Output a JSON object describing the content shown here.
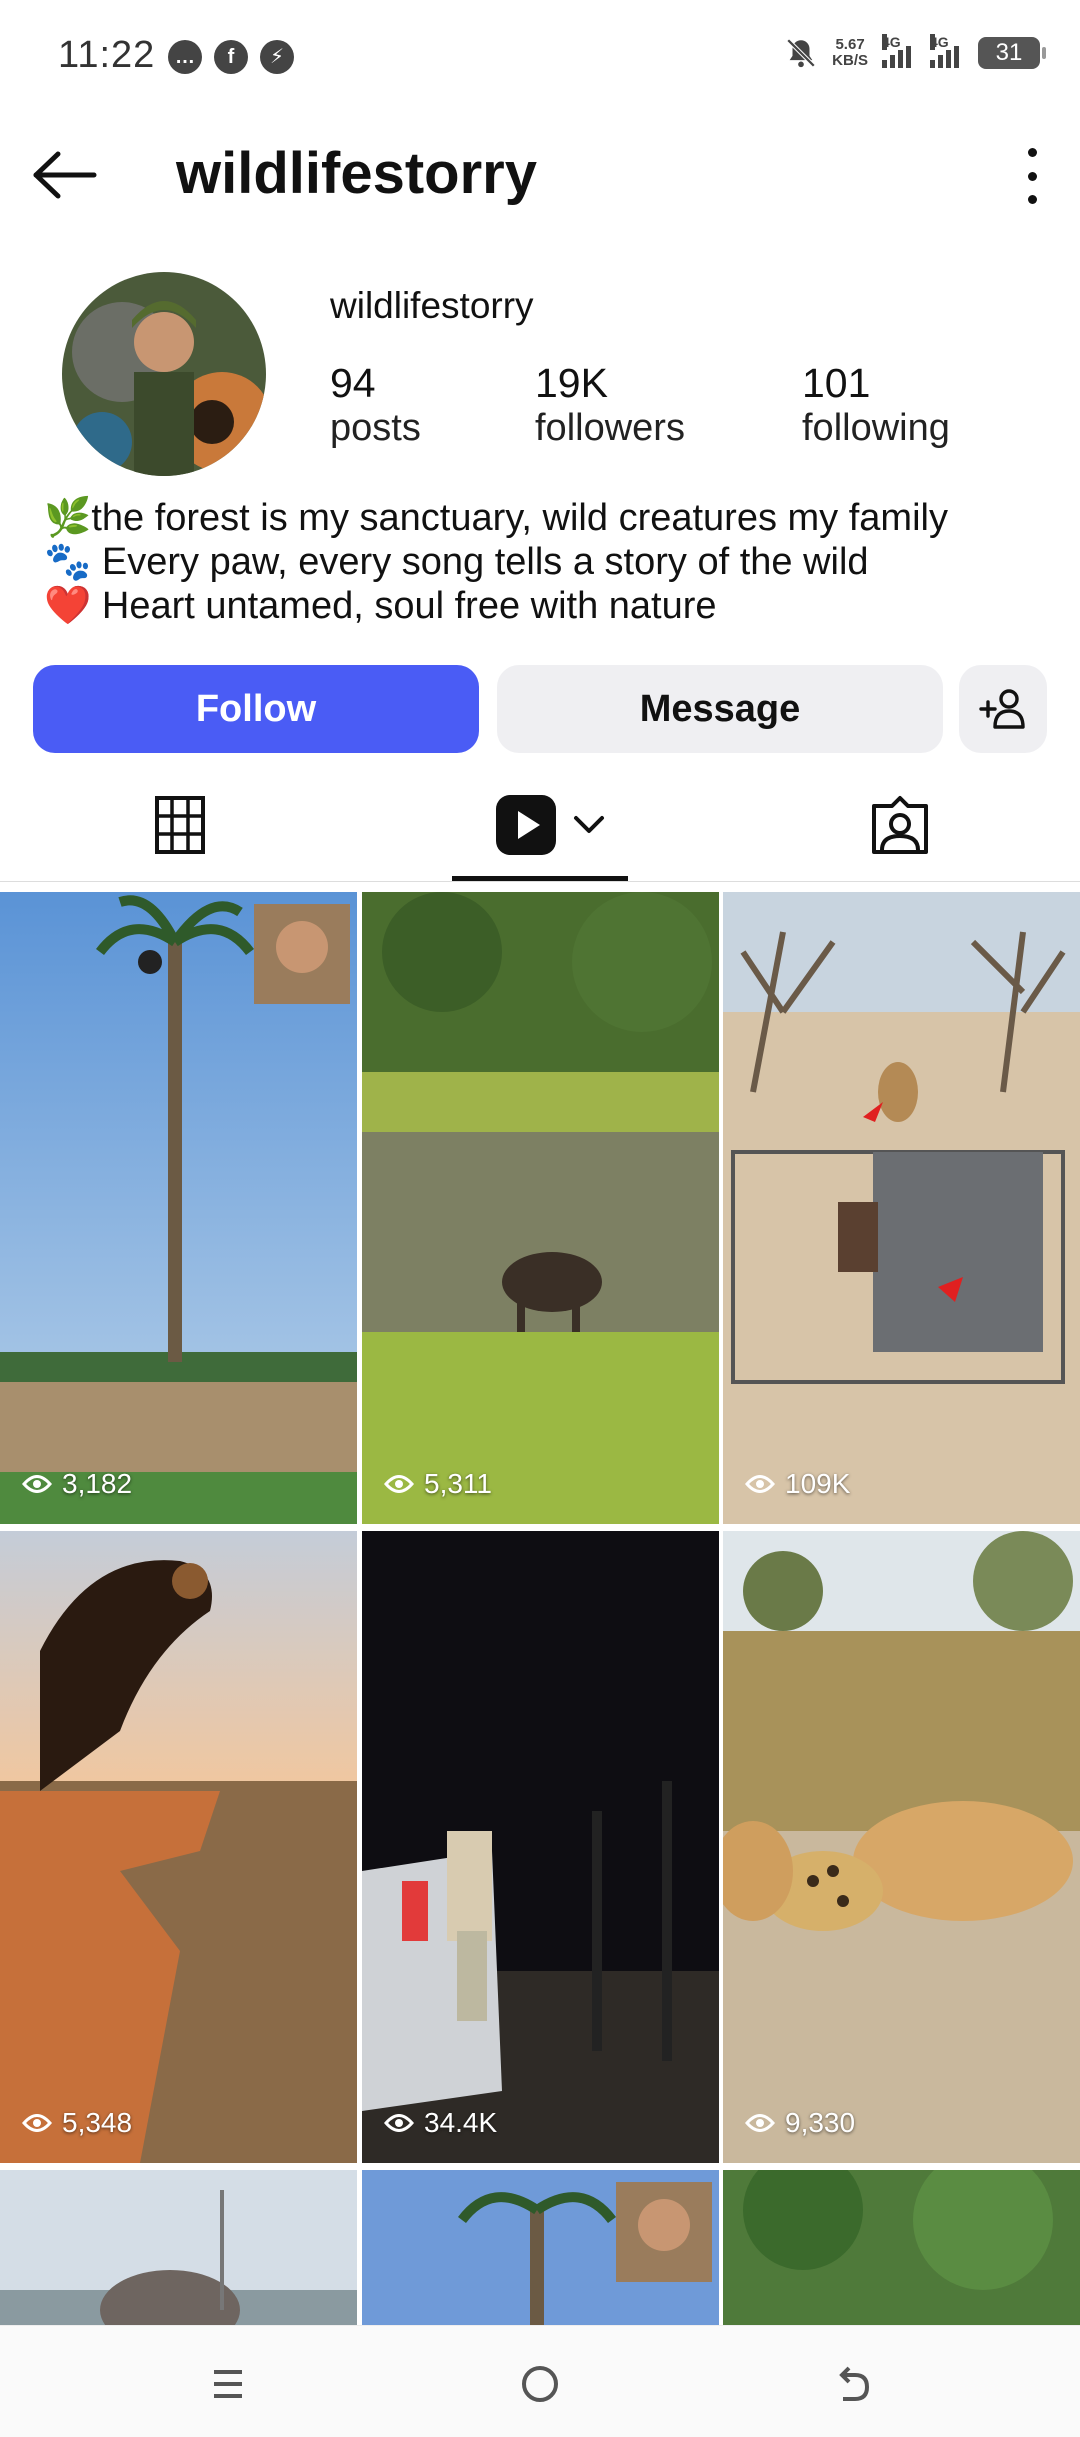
{
  "status_bar": {
    "time": "11:22",
    "net_speed_value": "5.67",
    "net_speed_unit": "KB/S",
    "sim1": "4G",
    "sim2": "4G",
    "battery": "31"
  },
  "header": {
    "title": "wildlifestorry"
  },
  "profile": {
    "username": "wildlifestorry",
    "stats": [
      {
        "value": "94",
        "label": "posts"
      },
      {
        "value": "19K",
        "label": "followers"
      },
      {
        "value": "101",
        "label": "following"
      }
    ],
    "bio": [
      "🌿the forest is my sanctuary, wild creatures my family",
      "🐾 Every paw, every song tells a story of the wild",
      "❤️ Heart untamed, soul free with nature"
    ]
  },
  "actions": {
    "follow_label": "Follow",
    "message_label": "Message"
  },
  "tabs": [
    {
      "name": "grid",
      "icon": "grid-icon"
    },
    {
      "name": "reels",
      "icon": "reels-icon",
      "active": true
    },
    {
      "name": "tagged",
      "icon": "tagged-icon"
    }
  ],
  "posts": [
    {
      "views": "3,182"
    },
    {
      "views": "5,311"
    },
    {
      "views": "109K"
    },
    {
      "views": "5,348"
    },
    {
      "views": "34.4K"
    },
    {
      "views": "9,330"
    }
  ],
  "colors": {
    "follow_button": "#4a5cf5",
    "secondary_button": "#efeff2"
  }
}
